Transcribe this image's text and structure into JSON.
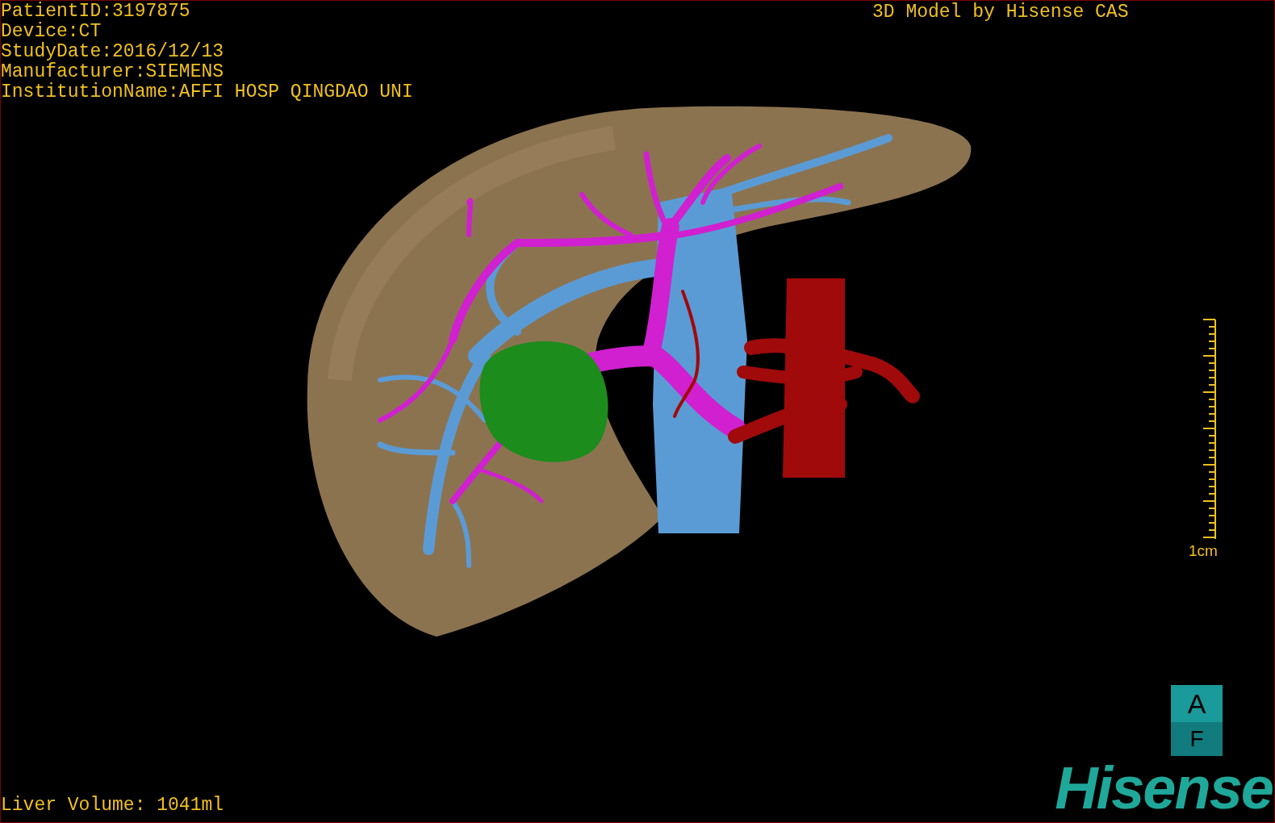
{
  "viewer": {
    "info_lines": [
      "PatientID:3197875",
      "Device:CT",
      "StudyDate:2016/12/13",
      "Manufacturer:SIEMENS",
      "InstitutionName:AFFI HOSP QINGDAO UNI"
    ],
    "title": "3D Model by Hisense CAS",
    "scale_label": "1cm",
    "orientation": {
      "top": "A",
      "bottom": "F"
    },
    "volume": "Liver Volume: 1041ml",
    "logo": "Hisense"
  }
}
